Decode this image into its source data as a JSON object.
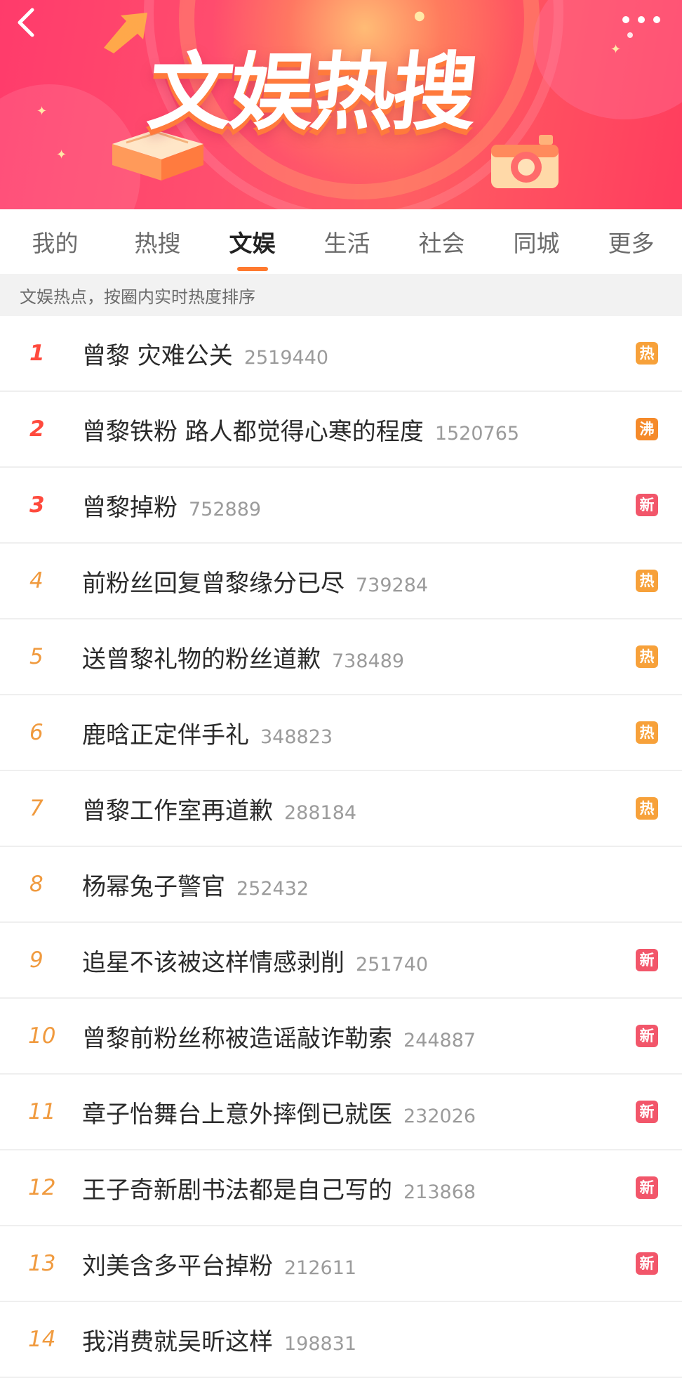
{
  "header": {
    "title": "文娱热搜"
  },
  "tabs": [
    {
      "label": "我的",
      "active": false
    },
    {
      "label": "热搜",
      "active": false
    },
    {
      "label": "文娱",
      "active": true
    },
    {
      "label": "生活",
      "active": false
    },
    {
      "label": "社会",
      "active": false
    },
    {
      "label": "同城",
      "active": false
    },
    {
      "label": "更多",
      "active": false
    }
  ],
  "note": "文娱热点，按圈内实时热度排序",
  "badge_colors": {
    "热": "#f7a13a",
    "沸": "#f58a2a",
    "新": "#f2566a"
  },
  "accent_color": "#ff7a2f",
  "items": [
    {
      "rank": "1",
      "title": "曾黎 灾难公关",
      "count": "2519440",
      "badge": "热"
    },
    {
      "rank": "2",
      "title": "曾黎铁粉 路人都觉得心寒的程度",
      "count": "1520765",
      "badge": "沸"
    },
    {
      "rank": "3",
      "title": "曾黎掉粉",
      "count": "752889",
      "badge": "新"
    },
    {
      "rank": "4",
      "title": "前粉丝回复曾黎缘分已尽",
      "count": "739284",
      "badge": "热"
    },
    {
      "rank": "5",
      "title": "送曾黎礼物的粉丝道歉",
      "count": "738489",
      "badge": "热"
    },
    {
      "rank": "6",
      "title": "鹿晗正定伴手礼",
      "count": "348823",
      "badge": "热"
    },
    {
      "rank": "7",
      "title": "曾黎工作室再道歉",
      "count": "288184",
      "badge": "热"
    },
    {
      "rank": "8",
      "title": "杨幂兔子警官",
      "count": "252432",
      "badge": ""
    },
    {
      "rank": "9",
      "title": "追星不该被这样情感剥削",
      "count": "251740",
      "badge": "新"
    },
    {
      "rank": "10",
      "title": "曾黎前粉丝称被造谣敲诈勒索",
      "count": "244887",
      "badge": "新"
    },
    {
      "rank": "11",
      "title": "章子怡舞台上意外摔倒已就医",
      "count": "232026",
      "badge": "新"
    },
    {
      "rank": "12",
      "title": "王子奇新剧书法都是自己写的",
      "count": "213868",
      "badge": "新"
    },
    {
      "rank": "13",
      "title": "刘美含多平台掉粉",
      "count": "212611",
      "badge": "新"
    },
    {
      "rank": "14",
      "title": "我消费就吴昕这样",
      "count": "198831",
      "badge": ""
    }
  ]
}
